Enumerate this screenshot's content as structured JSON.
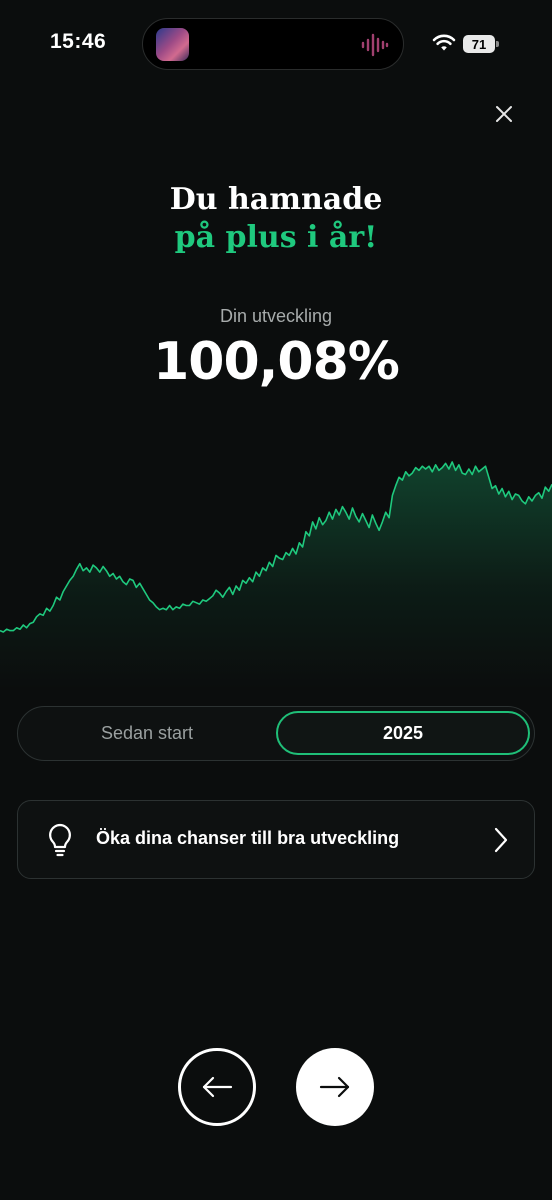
{
  "status_bar": {
    "time": "15:46",
    "battery": "71"
  },
  "close": {
    "icon": "close-icon"
  },
  "headline": {
    "line1": "Du hamnade",
    "line2": "på plus i år!",
    "accent_color": "#1fc97e"
  },
  "development": {
    "label": "Din utveckling",
    "value": "100,08%"
  },
  "chart_data": {
    "type": "area",
    "values": [
      8,
      7,
      9,
      8,
      8,
      10,
      9,
      12,
      10,
      13,
      14,
      18,
      20,
      19,
      24,
      22,
      26,
      32,
      30,
      36,
      40,
      44,
      47,
      52,
      56,
      51,
      53,
      50,
      55,
      53,
      50,
      54,
      51,
      47,
      49,
      45,
      47,
      43,
      41,
      45,
      44,
      39,
      42,
      38,
      34,
      30,
      28,
      25,
      23,
      24,
      23,
      26,
      23,
      25,
      24,
      27,
      26,
      26,
      29,
      28,
      27,
      30,
      29,
      31,
      33,
      37,
      35,
      32,
      36,
      39,
      34,
      40,
      37,
      44,
      42,
      46,
      43,
      50,
      47,
      53,
      51,
      57,
      54,
      62,
      60,
      59,
      64,
      62,
      67,
      63,
      71,
      68,
      79,
      76,
      86,
      81,
      89,
      84,
      87,
      93,
      88,
      95,
      91,
      97,
      93,
      88,
      96,
      90,
      86,
      92,
      87,
      82,
      91,
      85,
      80,
      86,
      93,
      89,
      105,
      112,
      118,
      116,
      122,
      119,
      121,
      125,
      123,
      126,
      124,
      126,
      122,
      127,
      123,
      125,
      128,
      124,
      129,
      123,
      127,
      121,
      120,
      124,
      120,
      126,
      122,
      124,
      126,
      118,
      110,
      112,
      106,
      110,
      104,
      108,
      102,
      106,
      105,
      101,
      99,
      104,
      101,
      105,
      107,
      103,
      111,
      108,
      113
    ],
    "color": "#1fc97e"
  },
  "segmented": {
    "options": [
      "Sedan start",
      "2025"
    ],
    "selected": "2025"
  },
  "tip": {
    "text": "Öka dina chanser till bra utveckling",
    "icon": "lightbulb-icon"
  },
  "navigation": {
    "back_icon": "arrow-left-icon",
    "next_icon": "arrow-right-icon"
  }
}
